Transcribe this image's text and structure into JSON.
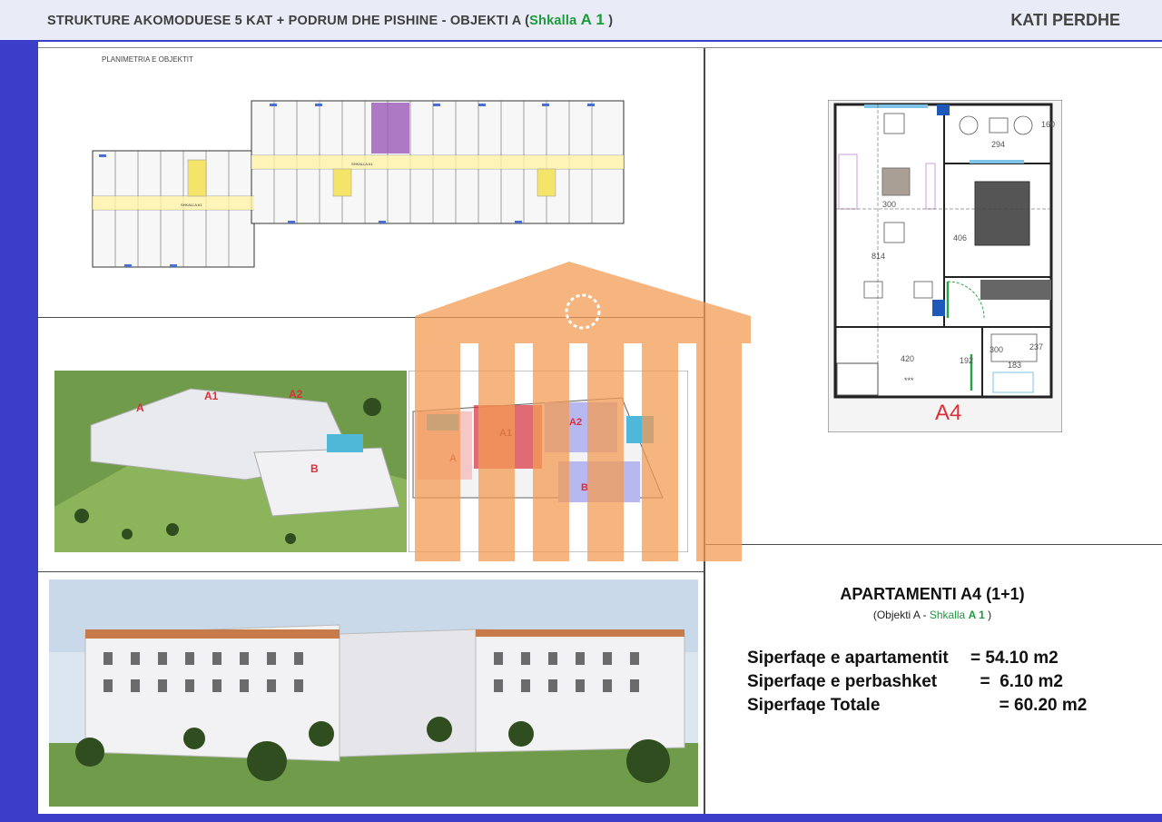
{
  "header": {
    "title_main": "STRUKTURE AKOMODUESE 5 KAT + PODRUM DHE PISHINE   -  OBJEKTI A (",
    "title_stair": "Shkalla",
    "title_stair_code": "A 1",
    "title_close": " )",
    "floor": "KATI PERDHE"
  },
  "plan": {
    "caption": "PLANIMETRIA E OBJEKTIT",
    "stair_labels": [
      "SHKALLA A1",
      "SHKALLA A1"
    ]
  },
  "aerial": {
    "labels": [
      "A",
      "A1",
      "A2",
      "B"
    ]
  },
  "site_plan": {
    "labels": [
      "A",
      "A1",
      "A2",
      "B"
    ]
  },
  "unit_plan": {
    "dims": [
      "294",
      "160",
      "300",
      "814",
      "406",
      "420",
      "192",
      "300",
      "237",
      "183"
    ],
    "stove_label": "***",
    "unit_code": "A4"
  },
  "apartment": {
    "title": "APARTAMENTI A4 (1+1)",
    "sub_prefix": "(Objekti A - ",
    "sub_stair": "Shkalla ",
    "sub_stair_code": "A 1",
    "sub_suffix": " )",
    "areas": [
      {
        "label": "Siperfaqe e apartamentit",
        "value": "= 54.10 m2"
      },
      {
        "label": "Siperfaqe e perbashket",
        "value": "  =  6.10 m2"
      },
      {
        "label": "Siperfaqe Totale",
        "value": "      = 60.20 m2"
      }
    ]
  },
  "colors": {
    "background_blue": "#3a3ec9",
    "header_band": "#e9ecf6",
    "accent_green": "#1b9b3a",
    "highlight_orange": "#f39b55",
    "highlight_red": "#d9303a",
    "apartment_purple": "#9b59b6"
  }
}
